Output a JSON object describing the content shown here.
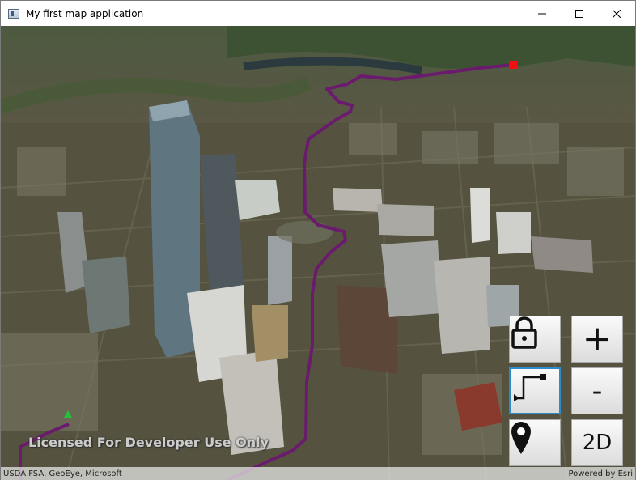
{
  "window": {
    "title": "My first map application"
  },
  "window_controls": {
    "minimize": "—",
    "maximize": "☐",
    "close": "✕"
  },
  "map": {
    "watermark": "Licensed For Developer Use Only",
    "attribution_left": "USDA FSA, GeoEye, Microsoft",
    "attribution_right": "Powered by Esri",
    "route_color": "#6a1b6e",
    "start_marker_color": "#22c33a",
    "end_marker_color": "#ee1111"
  },
  "controls": {
    "lock_icon": "lock-icon",
    "zoom_in_label": "+",
    "zoom_out_label": "-",
    "route_icon": "route-icon",
    "location_icon": "location-pin-icon",
    "view_toggle_label": "2D"
  }
}
